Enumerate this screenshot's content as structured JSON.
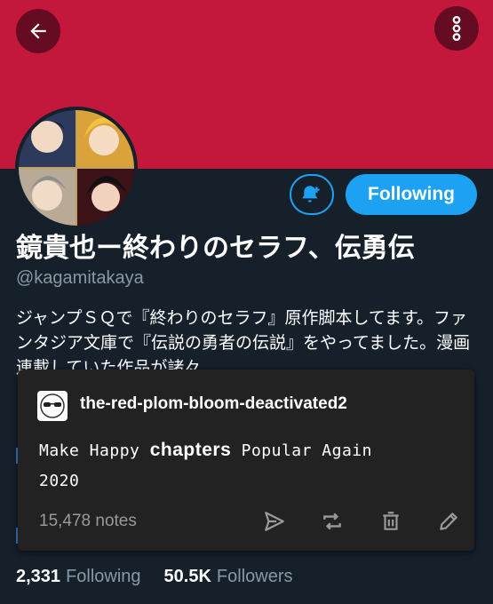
{
  "banner": {
    "color": "#c4173c"
  },
  "header": {
    "back_icon": "arrow-left-icon",
    "menu_icon": "vertical-dots-icon"
  },
  "profile": {
    "display_name": "鏡貴也ー終わりのセラフ、伝勇伝",
    "handle": "@kagamitakaya",
    "bio": "ジャンプＳＱで『終わりのセラフ』原作脚本してます。ファンタジア文庫で『伝説の勇者の伝説』をやってました。漫画連載していた作品が諸々",
    "following_button_label": "Following",
    "bell_icon": "bell-plus-icon"
  },
  "stats": {
    "following_count": "2,331",
    "following_label": "Following",
    "followers_count": "50.5K",
    "followers_label": "Followers"
  },
  "post_card": {
    "blog_name": "the-red-plom-bloom-deactivated2",
    "body_prefix": "Make Happy ",
    "body_word": "chapters",
    "body_suffix": " Popular Again",
    "body_line2": "2020",
    "notes": "15,478 notes",
    "actions": [
      "send-icon",
      "reblog-icon",
      "delete-icon",
      "edit-icon"
    ]
  },
  "colors": {
    "accent": "#1da1f2",
    "background": "#15202b",
    "card": "#222222",
    "muted": "#8899a6"
  }
}
